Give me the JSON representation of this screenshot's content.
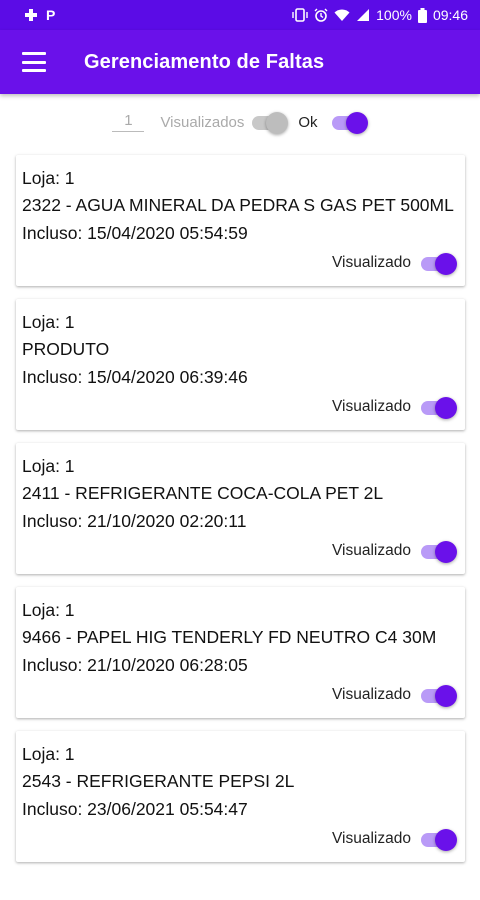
{
  "status_bar": {
    "left_icons": [
      "gamepad-icon",
      "p-icon"
    ],
    "p_glyph": "P",
    "battery_text": "100%",
    "time": "09:46"
  },
  "app_bar": {
    "title": "Gerenciamento de Faltas",
    "menu_icon": "hamburger-menu-icon"
  },
  "filters": {
    "store_value": "1",
    "visualizados_label": "Visualizados",
    "visualizados_on": false,
    "ok_label": "Ok",
    "ok_on": true
  },
  "cards": [
    {
      "loja": "Loja: 1",
      "produto": "2322 - AGUA MINERAL DA PEDRA S GAS PET 500ML",
      "incluso": "Incluso: 15/04/2020 05:54:59",
      "toggle_label": "Visualizado",
      "visualizado": true
    },
    {
      "loja": "Loja: 1",
      "produto": "PRODUTO",
      "incluso": "Incluso: 15/04/2020 06:39:46",
      "toggle_label": "Visualizado",
      "visualizado": true
    },
    {
      "loja": "Loja: 1",
      "produto": "2411 - REFRIGERANTE COCA-COLA PET 2L",
      "incluso": "Incluso: 21/10/2020 02:20:11",
      "toggle_label": "Visualizado",
      "visualizado": true
    },
    {
      "loja": "Loja: 1",
      "produto": "9466 - PAPEL HIG TENDERLY FD NEUTRO C4 30M",
      "incluso": "Incluso: 21/10/2020 06:28:05",
      "toggle_label": "Visualizado",
      "visualizado": true
    },
    {
      "loja": "Loja: 1",
      "produto": "2543 - REFRIGERANTE PEPSI  2L",
      "incluso": "Incluso: 23/06/2021 05:54:47",
      "toggle_label": "Visualizado",
      "visualizado": true
    }
  ],
  "colors": {
    "status_bar": "#5b0ce6",
    "app_bar": "#6a11ea",
    "accent": "#6a11ea",
    "accent_track": "#b99af7"
  }
}
